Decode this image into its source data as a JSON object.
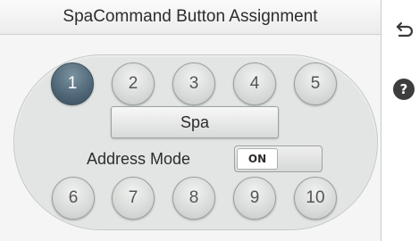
{
  "header": {
    "title": "SpaCommand Button Assignment"
  },
  "buttons": {
    "top_row": [
      "1",
      "2",
      "3",
      "4",
      "5"
    ],
    "bottom_row": [
      "6",
      "7",
      "8",
      "9",
      "10"
    ],
    "selected": "1"
  },
  "assignment": {
    "label": "Spa"
  },
  "address_mode": {
    "label": "Address Mode",
    "state": "ON"
  },
  "sidebar": {
    "back_icon": "back-arrow-icon",
    "help_icon": "help-icon",
    "help_glyph": "?"
  },
  "colors": {
    "selected": "#52697a",
    "panel": "#e2e5e3"
  }
}
